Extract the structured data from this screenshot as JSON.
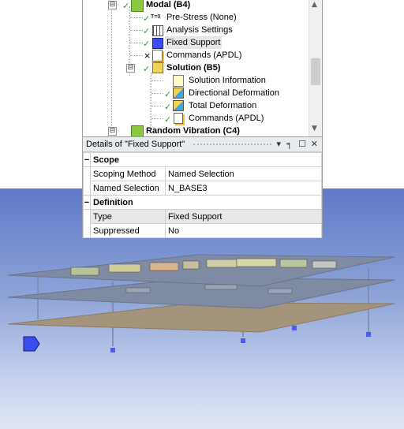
{
  "tree": {
    "items": [
      {
        "label": "Modal (B4)",
        "bold": true
      },
      {
        "label": "Pre-Stress (None)",
        "icon_text": "T=0"
      },
      {
        "label": "Analysis Settings"
      },
      {
        "label": "Fixed Support",
        "selected": true
      },
      {
        "label": "Commands (APDL)"
      },
      {
        "label": "Solution (B5)",
        "bold": true
      },
      {
        "label": "Solution Information"
      },
      {
        "label": "Directional Deformation"
      },
      {
        "label": "Total Deformation"
      },
      {
        "label": "Commands (APDL)"
      },
      {
        "label": "Random Vibration (C4)",
        "bold": true
      }
    ],
    "expander_glyph": "⊟",
    "check_glyph": "✓",
    "x_glyph": "×"
  },
  "details": {
    "title": "Details of \"Fixed Support\"",
    "controls": {
      "dropdown": "▾",
      "pin": "╕",
      "maximize": "☐",
      "close": "✕"
    },
    "sections": [
      {
        "name": "Scope",
        "rows": [
          {
            "key": "Scoping Method",
            "value": "Named Selection"
          },
          {
            "key": "Named Selection",
            "value": "N_BASE3"
          }
        ]
      },
      {
        "name": "Definition",
        "rows": [
          {
            "key": "Type",
            "value": "Fixed Support"
          },
          {
            "key": "Suppressed",
            "value": "No"
          }
        ]
      }
    ],
    "collapse_glyph": "−"
  },
  "scrollbar": {
    "up": "▲",
    "down": "▼"
  },
  "colors": {
    "check": "#2a9a2a",
    "support": "#4a5cf0",
    "plate": "#a5947c",
    "viewport_top": "#5f79c8",
    "viewport_bottom": "#dfe6f6"
  }
}
